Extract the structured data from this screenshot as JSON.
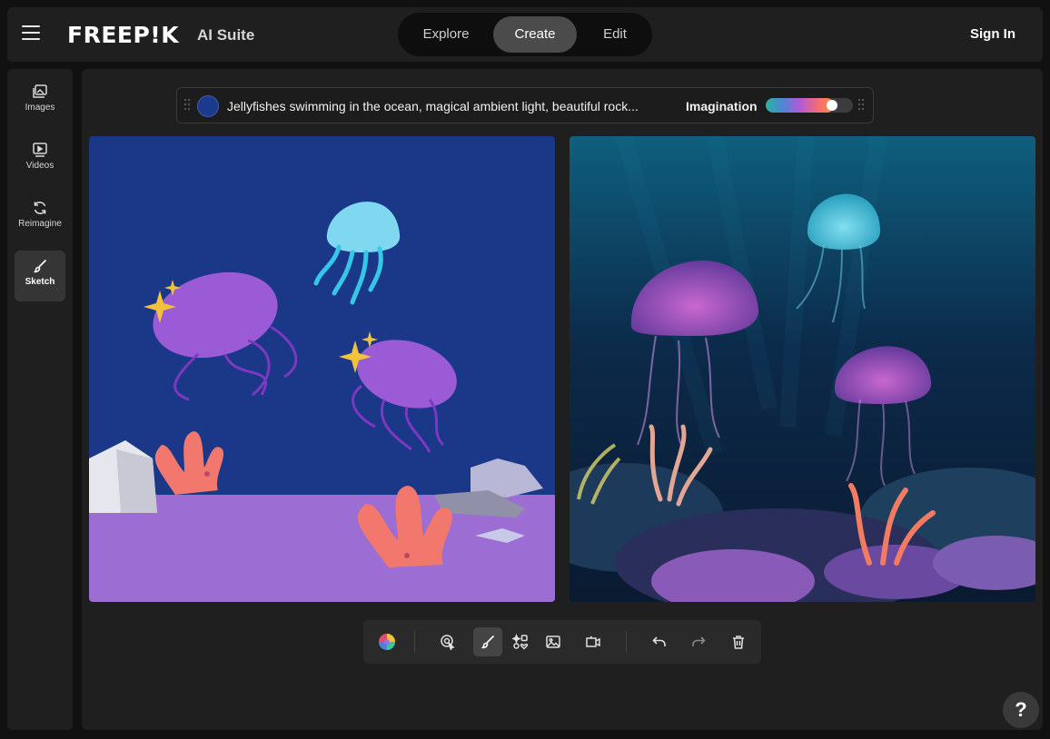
{
  "header": {
    "logo": "FREEP!K",
    "suite": "AI Suite",
    "tabs": [
      {
        "label": "Explore"
      },
      {
        "label": "Create"
      },
      {
        "label": "Edit"
      }
    ],
    "active_tab": "Create",
    "sign_in": "Sign In"
  },
  "sidebar": {
    "items": [
      {
        "label": "Images",
        "icon": "images-icon"
      },
      {
        "label": "Videos",
        "icon": "video-icon"
      },
      {
        "label": "Reimagine",
        "icon": "refresh-icon"
      },
      {
        "label": "Sketch",
        "icon": "brush-icon"
      }
    ],
    "active": "Sketch"
  },
  "prompt": {
    "color": "#1b3a8d",
    "text": "Jellyfishes swimming in the ocean, magical ambient light, beautiful rock...",
    "imagination_label": "Imagination",
    "imagination_level": 0.72
  },
  "toolbar": {
    "tools": [
      "color-wheel-icon",
      "select-pointer-icon",
      "brush-icon",
      "shapes-icon",
      "image-icon",
      "camera-icon",
      "undo-icon",
      "redo-icon",
      "trash-icon"
    ],
    "active_tool": "brush-icon"
  },
  "help": {
    "label": "?"
  },
  "colors": {
    "sketch_sky": "#1a3788",
    "sketch_ground": "#9c6dd2",
    "accent_active": "#4b4b4b"
  }
}
